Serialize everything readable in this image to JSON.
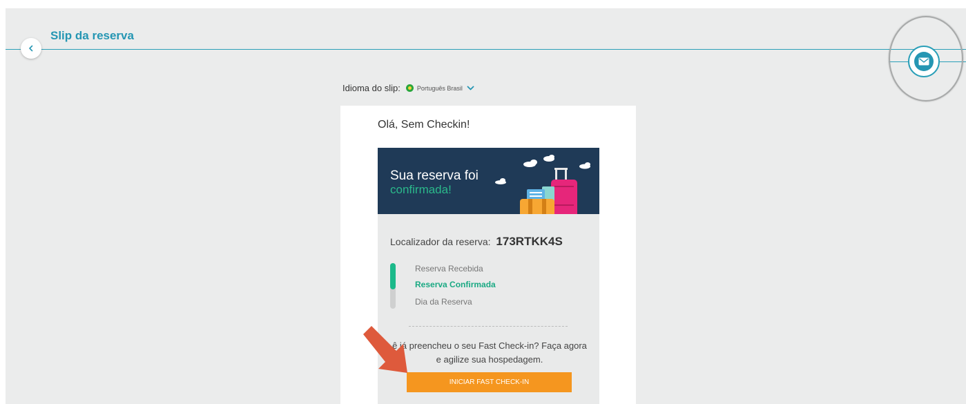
{
  "header": {
    "title": "Slip da reserva"
  },
  "language": {
    "label": "Idioma do slip:",
    "selected": "Português Brasil"
  },
  "card": {
    "greeting": "Olá, Sem Checkin!",
    "banner": {
      "line1": "Sua reserva foi",
      "line2": "confirmada!"
    },
    "locator": {
      "label": "Localizador da reserva:",
      "code": "173RTKK4S"
    },
    "steps": [
      {
        "label": "Reserva Recebida"
      },
      {
        "label": "Reserva Confirmada"
      },
      {
        "label": "Dia da Reserva"
      }
    ],
    "progress_fraction": 0.5,
    "fast_checkin": {
      "text": "ê já preencheu o seu Fast Check-in? Faça agora e agilize sua hospedagem.",
      "button_label": "INICIAR FAST CHECK-IN"
    }
  },
  "icons": {
    "back": "chevron-left-icon",
    "mail": "mail-icon",
    "flag": "brazil-flag-icon",
    "dropdown": "chevron-down-icon",
    "annotation": "arrow-annotation-icon"
  },
  "colors": {
    "accent": "#2596b3",
    "banner_bg": "#1f3a57",
    "success": "#1bb98a",
    "cta": "#f5961f",
    "annotation_arrow": "#de5a3c"
  }
}
